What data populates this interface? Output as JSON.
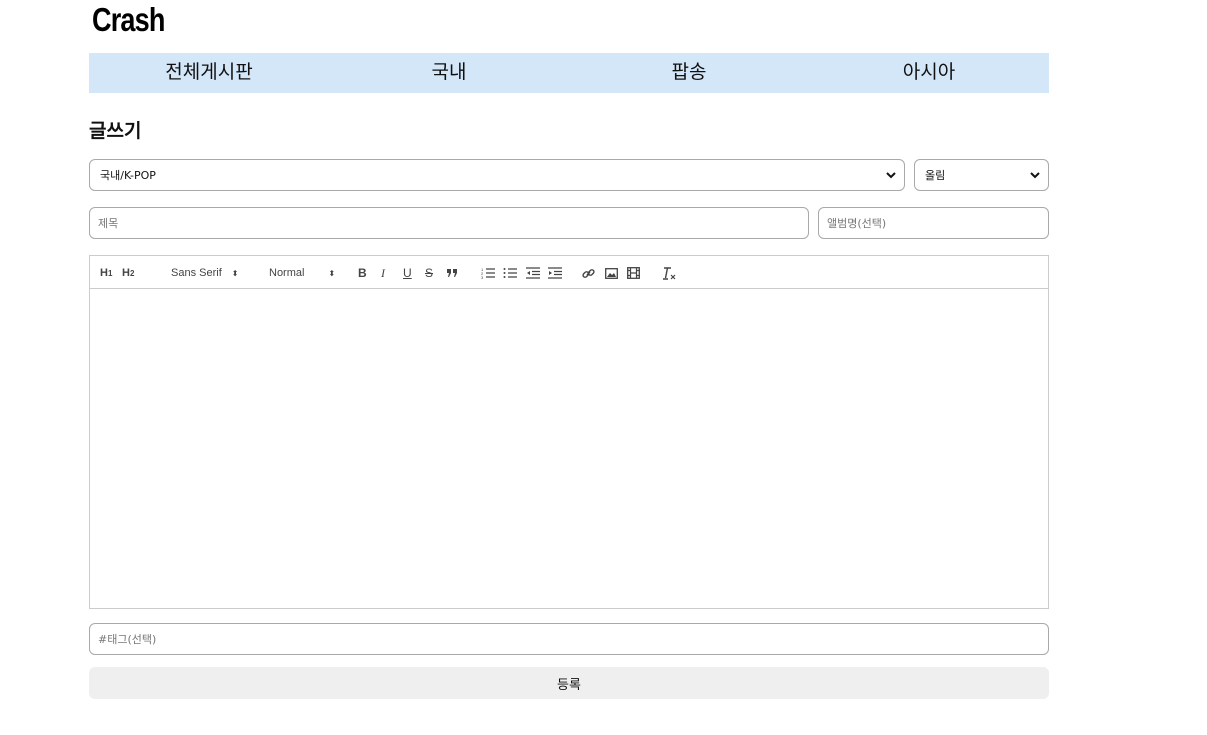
{
  "site": {
    "logo": "Crash"
  },
  "nav": {
    "items": [
      "전체게시판",
      "국내",
      "팝송",
      "아시아"
    ]
  },
  "page": {
    "heading": "글쓰기"
  },
  "form": {
    "category_select": "국내/K-POP",
    "sub_select": "올림",
    "title_placeholder": "제목",
    "album_placeholder": "앨범명(선택)",
    "tag_placeholder": "#태그(선택)",
    "submit_label": "등록"
  },
  "toolbar": {
    "h1": "H1",
    "h2": "H2",
    "font_picker": "Sans Serif",
    "size_picker": "Normal",
    "bold": "B",
    "italic": "I",
    "underline": "U",
    "strike": "S"
  }
}
